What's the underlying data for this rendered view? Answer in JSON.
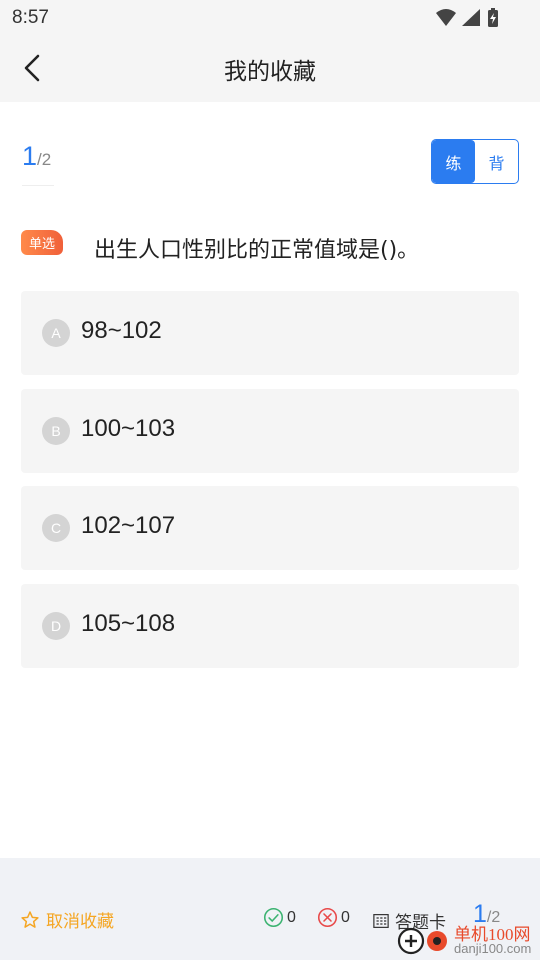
{
  "status": {
    "time": "8:57"
  },
  "header": {
    "title": "我的收藏"
  },
  "progress": {
    "current": "1",
    "total": "/2"
  },
  "mode": {
    "practice": "练",
    "recite": "背",
    "active": "practice"
  },
  "question": {
    "type": "单选",
    "text": "出生人口性别比的正常值域是()。"
  },
  "options": [
    {
      "letter": "A",
      "text": "98~102"
    },
    {
      "letter": "B",
      "text": "100~103"
    },
    {
      "letter": "C",
      "text": "102~107"
    },
    {
      "letter": "D",
      "text": "105~108"
    }
  ],
  "bottom": {
    "unfavorite": "取消收藏",
    "correct_count": "0",
    "wrong_count": "0",
    "answer_card": "答题卡",
    "current": "1",
    "total": "/2"
  },
  "watermark": {
    "name": "单机100网",
    "url": "danji100.com"
  },
  "colors": {
    "accent": "#2b7cf0",
    "favorite": "#f5a623",
    "correct": "#3cb371",
    "wrong": "#e84a4a"
  }
}
